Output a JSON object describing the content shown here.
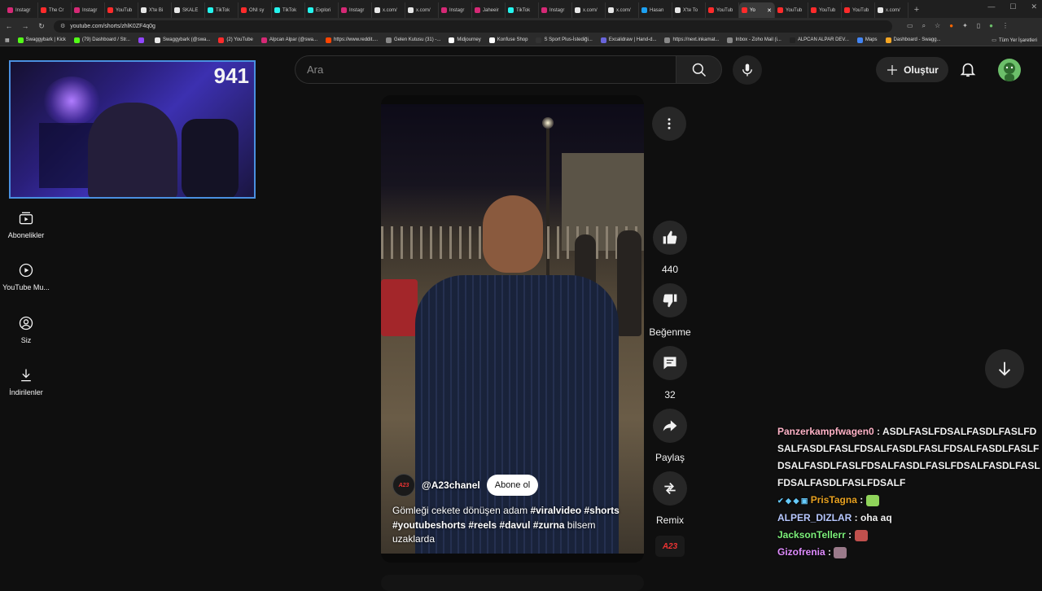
{
  "browser": {
    "tabs": [
      {
        "label": "Instagr",
        "color": "#d62976"
      },
      {
        "label": "The Cr",
        "color": "#ff2b2b"
      },
      {
        "label": "Instagr",
        "color": "#d62976"
      },
      {
        "label": "YouTub",
        "color": "#ff2b2b"
      },
      {
        "label": "X'te Bi",
        "color": "#e7e7e7"
      },
      {
        "label": "SKALE",
        "color": "#e7e7e7"
      },
      {
        "label": "TikTok",
        "color": "#25f4ee"
      },
      {
        "label": "ONI sy",
        "color": "#ff2b2b"
      },
      {
        "label": "TikTok",
        "color": "#25f4ee"
      },
      {
        "label": "Explori",
        "color": "#25f4ee"
      },
      {
        "label": "Instagr",
        "color": "#d62976"
      },
      {
        "label": "x.com/",
        "color": "#e7e7e7"
      },
      {
        "label": "x.com/",
        "color": "#e7e7e7"
      },
      {
        "label": "Instagr",
        "color": "#d62976"
      },
      {
        "label": "Jaheeir",
        "color": "#d62976"
      },
      {
        "label": "TikTok",
        "color": "#25f4ee"
      },
      {
        "label": "Instagr",
        "color": "#d62976"
      },
      {
        "label": "x.com/",
        "color": "#e7e7e7"
      },
      {
        "label": "x.com/",
        "color": "#e7e7e7"
      },
      {
        "label": "Hasan",
        "color": "#1da1f2"
      },
      {
        "label": "X'te To",
        "color": "#e7e7e7"
      },
      {
        "label": "YouTub",
        "color": "#ff2b2b"
      },
      {
        "label": "Yo",
        "color": "#ff2b2b",
        "active": true
      },
      {
        "label": "YouTub",
        "color": "#ff2b2b"
      },
      {
        "label": "YouTub",
        "color": "#ff2b2b"
      },
      {
        "label": "YouTub",
        "color": "#ff2b2b"
      },
      {
        "label": "x.com/",
        "color": "#e7e7e7"
      }
    ],
    "url": "youtube.com/shorts/zhlK0ZF4q0g",
    "bookmarks": [
      {
        "label": "Swaggybark | Kick",
        "color": "#53fc18"
      },
      {
        "label": "(79) Dashboard / Str...",
        "color": "#53fc18"
      },
      {
        "label": "",
        "color": "#9146ff"
      },
      {
        "label": "Swaggybark (@swa...",
        "color": "#e7e7e7"
      },
      {
        "label": "(2) YouTube",
        "color": "#ff2b2b"
      },
      {
        "label": "Alpcan Alpar (@swa...",
        "color": "#d62976"
      },
      {
        "label": "https://www.reddit....",
        "color": "#ff4500"
      },
      {
        "label": "Gelen Kutusu (31) -...",
        "color": "#888888"
      },
      {
        "label": "Midjourney",
        "color": "#ffffff"
      },
      {
        "label": "Konfuse Shop",
        "color": "#ffffff"
      },
      {
        "label": "S Sport Plus-İstediği...",
        "color": "#333333"
      },
      {
        "label": "Excalidraw | Hand-d...",
        "color": "#6965db"
      },
      {
        "label": "https://next.inkamat...",
        "color": "#888888"
      },
      {
        "label": "Inbox - Zoho Mail (i...",
        "color": "#888888"
      },
      {
        "label": "ALPCAN ALPAR DEV...",
        "color": "#222222"
      },
      {
        "label": "Maps",
        "color": "#4285f4"
      },
      {
        "label": "Dashboard - Swagg...",
        "color": "#f5a623"
      }
    ],
    "all_bookmarks": "Tüm Yer İşaretleri"
  },
  "webcam": {
    "viewer_count": "941"
  },
  "guide": [
    {
      "label": "Abonelikler",
      "icon": "subscriptions-icon"
    },
    {
      "label": "YouTube Mu...",
      "icon": "youtube-music-icon"
    },
    {
      "label": "Siz",
      "icon": "you-icon"
    },
    {
      "label": "İndirilenler",
      "icon": "downloads-icon"
    }
  ],
  "search": {
    "placeholder": "Ara"
  },
  "header": {
    "create_label": "Oluştur"
  },
  "short": {
    "channel_logo": "A23",
    "channel": "@A23chanel",
    "subscribe_label": "Abone ol",
    "desc_plain_1": "Gömleği cekete dönüşen adam ",
    "hashtag_1": "#viralvideo",
    "hashtag_2": "#shorts",
    "hashtag_3": "#youtubeshorts",
    "hashtag_4": "#reels",
    "hashtag_5": "#davul",
    "hashtag_6": "#zurna",
    "desc_plain_2": " bilsem uzaklarda"
  },
  "actions": {
    "likes": "440",
    "dislike_label": "Beğenme",
    "comments": "32",
    "share_label": "Paylaş",
    "remix_label": "Remix"
  },
  "chat": [
    {
      "user": "Panzerkampfwagen0",
      "color": "#ffb3c7",
      "message": "ASDLFASLFDSALFASDLFASLFDSALFASDLFASLFDSALFASDLFASLFDSALFASDLFASLFDSALFASDLFASLFDSALFASDLFASLFDSALFASDLFASLFDSALFASDLFASLFDSALF",
      "emote": null
    },
    {
      "user": "PrisTagna",
      "color": "#e6a020",
      "message": "",
      "emote": "#8fd35a",
      "badges": true
    },
    {
      "user": "ALPER_DIZLAR",
      "color": "#b7c8ff",
      "message": "oha aq",
      "emote": null
    },
    {
      "user": "JacksonTellerr",
      "color": "#7cf07a",
      "message": "",
      "emote": "#c0504d"
    },
    {
      "user": "Gizofrenia",
      "color": "#e08cff",
      "message": "",
      "emote": "#9a7a8a"
    }
  ],
  "colors": {
    "accent": "#ff0000",
    "webcam_border": "#4a8fe0",
    "background": "#0f0f0f"
  }
}
